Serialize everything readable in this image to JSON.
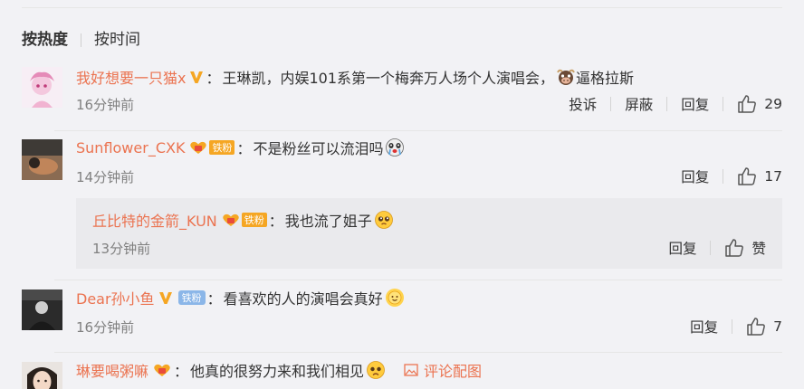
{
  "sort": {
    "hot_label": "按热度",
    "time_label": "按时间"
  },
  "comments": [
    {
      "username": "我好想要一只猫x",
      "colon": "：",
      "text": "王琳凯，内娱101系第一个梅奔万人场个人演唱会，",
      "text_after_emoji": "逼格拉斯",
      "time": "16分钟前",
      "report_label": "投诉",
      "block_label": "屏蔽",
      "reply_label": "回复",
      "likes": "29"
    },
    {
      "username": "Sunflower_CXK",
      "badge_label": "铁粉",
      "colon": "：",
      "text": "不是粉丝可以流泪吗",
      "time": "14分钟前",
      "reply_label": "回复",
      "likes": "17",
      "reply": {
        "username": "丘比特的金箭_KUN",
        "badge_label": "铁粉",
        "colon": "：",
        "text": "我也流了姐子",
        "time": "13分钟前",
        "reply_label": "回复",
        "like_label": "赞"
      }
    },
    {
      "username": "Dear孙小鱼",
      "badge_label": "铁粉",
      "colon": "：",
      "text": "看喜欢的人的演唱会真好",
      "time": "16分钟前",
      "reply_label": "回复",
      "likes": "7"
    },
    {
      "username": "琳要喝粥嘛",
      "colon": "：",
      "text": "他真的很努力来和我们相见",
      "image_link_label": "评论配图"
    }
  ],
  "icons": {
    "verified": "verified-v-icon",
    "fan_heart": "fan-heart-icon",
    "like": "thumbs-up-icon",
    "image": "image-icon"
  },
  "colors": {
    "username": "#eb7350",
    "text": "#333333",
    "meta": "#808080",
    "background": "#f2f2f5",
    "reply_background": "#eaeaed",
    "verified": "#f5a623",
    "fan_badge": "#f5a623",
    "fan_badge_blue": "#8bb6e8"
  }
}
